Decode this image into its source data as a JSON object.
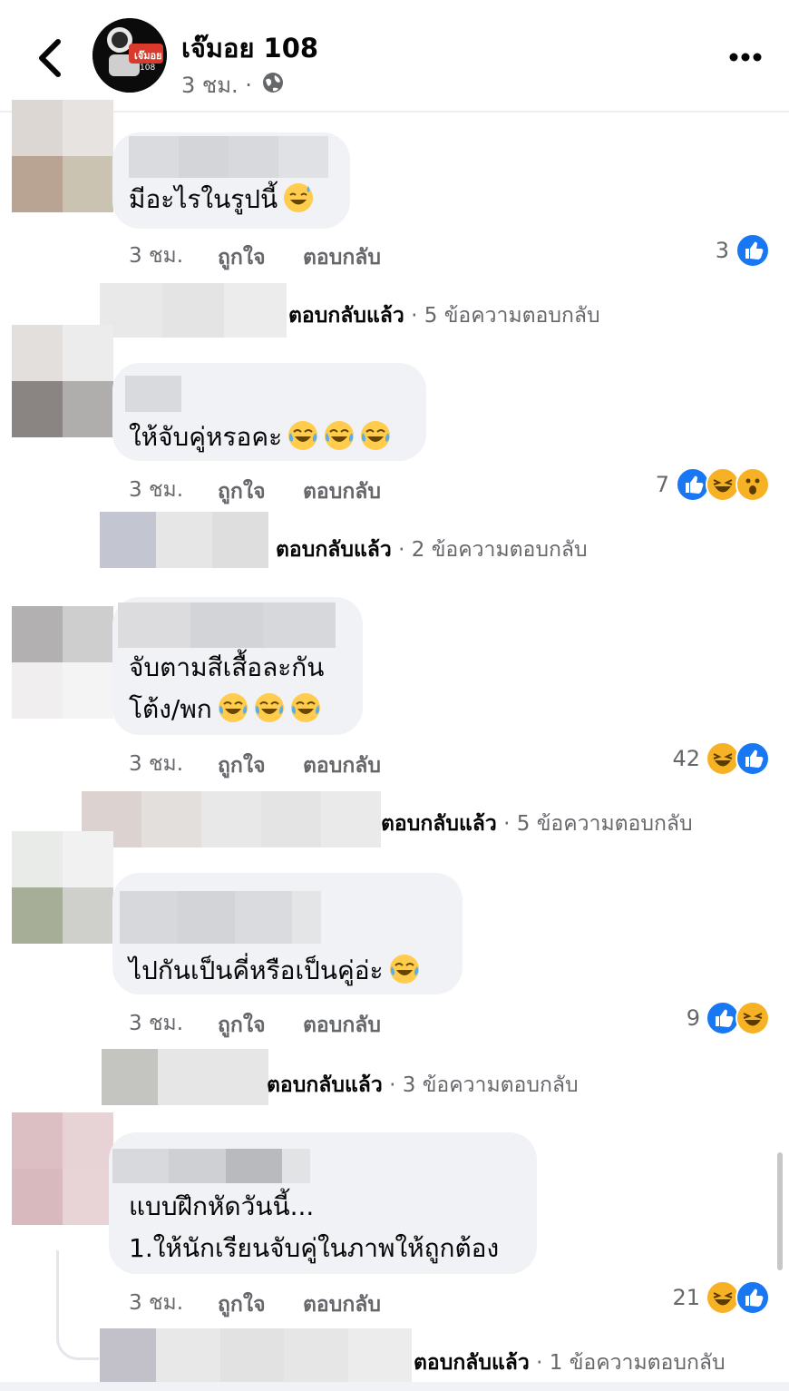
{
  "header": {
    "back_icon": "back-chevron-icon",
    "page_name": "เจ๊มอย 108",
    "avatar_text": "เจ๊มอย",
    "avatar_subtext": "108",
    "meta": "3 ชม. ·",
    "audience_icon": "globe-icon",
    "more_icon": "more-dots-icon"
  },
  "actions": {
    "like": "ถูกใจ",
    "reply": "ตอบกลับ"
  },
  "comments": [
    {
      "lines": [
        "มีอะไรในรูปนี้"
      ],
      "time": "3 ชม.",
      "reaction_count": "3",
      "reactions": [
        "like"
      ],
      "replies_prefix": "ตอบกลับแล้ว",
      "replies_suffix": " · 5 ข้อความตอบกลับ"
    },
    {
      "lines": [
        "ให้จับคู่หรอคะ"
      ],
      "time": "3 ชม.",
      "reaction_count": "7",
      "reactions": [
        "like",
        "haha",
        "wow"
      ],
      "replies_prefix": "ตอบกลับแล้ว",
      "replies_suffix": " · 2 ข้อความตอบกลับ"
    },
    {
      "lines": [
        "จับตามสีเสื้อละกัน",
        "โต้ง/พก"
      ],
      "time": "3 ชม.",
      "reaction_count": "42",
      "reactions": [
        "haha",
        "like"
      ],
      "replies_prefix": "ตอบกลับแล้ว",
      "replies_suffix": " · 5 ข้อความตอบกลับ"
    },
    {
      "lines": [
        "ไปกันเป็นคี่หรือเป็นคู่อ่ะ"
      ],
      "time": "3 ชม.",
      "reaction_count": "9",
      "reactions": [
        "like",
        "haha"
      ],
      "replies_prefix": "ตอบกลับแล้ว",
      "replies_suffix": " · 3 ข้อความตอบกลับ"
    },
    {
      "lines": [
        "แบบฝึกหัดวันนี้...",
        "1.ให้นักเรียนจับคู่ในภาพให้ถูกต้อง"
      ],
      "time": "3 ชม.",
      "reaction_count": "21",
      "reactions": [
        "haha",
        "like"
      ],
      "replies_prefix": "ตอบกลับแล้ว",
      "replies_suffix": " · 1 ข้อความตอบกลับ"
    }
  ],
  "colors": {
    "like_blue": "#1877f2",
    "haha_yellow": "#f7b125",
    "bubble_gray": "#f0f2f5",
    "secondary_text": "#65676b"
  }
}
